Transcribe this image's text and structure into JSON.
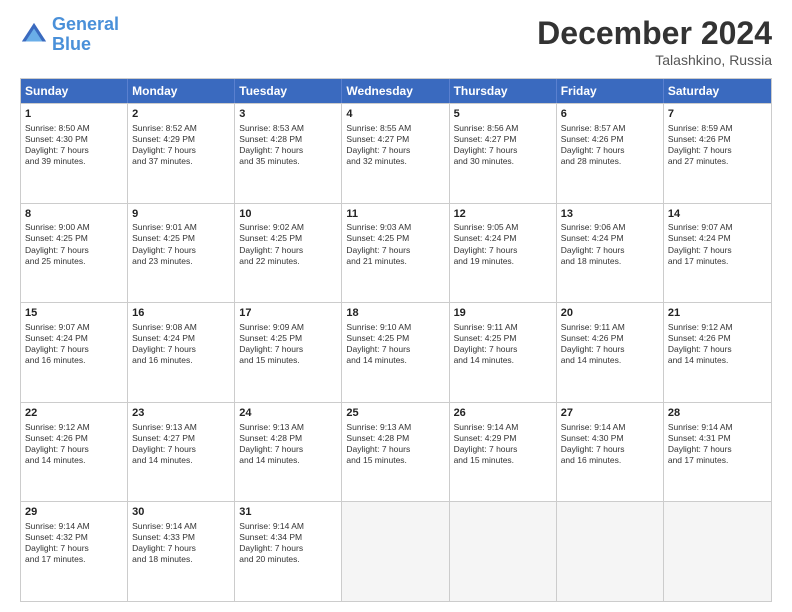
{
  "logo": {
    "line1": "General",
    "line2": "Blue"
  },
  "title": "December 2024",
  "subtitle": "Talashkino, Russia",
  "header_days": [
    "Sunday",
    "Monday",
    "Tuesday",
    "Wednesday",
    "Thursday",
    "Friday",
    "Saturday"
  ],
  "weeks": [
    [
      {
        "day": "1",
        "lines": [
          "Sunrise: 8:50 AM",
          "Sunset: 4:30 PM",
          "Daylight: 7 hours",
          "and 39 minutes."
        ]
      },
      {
        "day": "2",
        "lines": [
          "Sunrise: 8:52 AM",
          "Sunset: 4:29 PM",
          "Daylight: 7 hours",
          "and 37 minutes."
        ]
      },
      {
        "day": "3",
        "lines": [
          "Sunrise: 8:53 AM",
          "Sunset: 4:28 PM",
          "Daylight: 7 hours",
          "and 35 minutes."
        ]
      },
      {
        "day": "4",
        "lines": [
          "Sunrise: 8:55 AM",
          "Sunset: 4:27 PM",
          "Daylight: 7 hours",
          "and 32 minutes."
        ]
      },
      {
        "day": "5",
        "lines": [
          "Sunrise: 8:56 AM",
          "Sunset: 4:27 PM",
          "Daylight: 7 hours",
          "and 30 minutes."
        ]
      },
      {
        "day": "6",
        "lines": [
          "Sunrise: 8:57 AM",
          "Sunset: 4:26 PM",
          "Daylight: 7 hours",
          "and 28 minutes."
        ]
      },
      {
        "day": "7",
        "lines": [
          "Sunrise: 8:59 AM",
          "Sunset: 4:26 PM",
          "Daylight: 7 hours",
          "and 27 minutes."
        ]
      }
    ],
    [
      {
        "day": "8",
        "lines": [
          "Sunrise: 9:00 AM",
          "Sunset: 4:25 PM",
          "Daylight: 7 hours",
          "and 25 minutes."
        ]
      },
      {
        "day": "9",
        "lines": [
          "Sunrise: 9:01 AM",
          "Sunset: 4:25 PM",
          "Daylight: 7 hours",
          "and 23 minutes."
        ]
      },
      {
        "day": "10",
        "lines": [
          "Sunrise: 9:02 AM",
          "Sunset: 4:25 PM",
          "Daylight: 7 hours",
          "and 22 minutes."
        ]
      },
      {
        "day": "11",
        "lines": [
          "Sunrise: 9:03 AM",
          "Sunset: 4:25 PM",
          "Daylight: 7 hours",
          "and 21 minutes."
        ]
      },
      {
        "day": "12",
        "lines": [
          "Sunrise: 9:05 AM",
          "Sunset: 4:24 PM",
          "Daylight: 7 hours",
          "and 19 minutes."
        ]
      },
      {
        "day": "13",
        "lines": [
          "Sunrise: 9:06 AM",
          "Sunset: 4:24 PM",
          "Daylight: 7 hours",
          "and 18 minutes."
        ]
      },
      {
        "day": "14",
        "lines": [
          "Sunrise: 9:07 AM",
          "Sunset: 4:24 PM",
          "Daylight: 7 hours",
          "and 17 minutes."
        ]
      }
    ],
    [
      {
        "day": "15",
        "lines": [
          "Sunrise: 9:07 AM",
          "Sunset: 4:24 PM",
          "Daylight: 7 hours",
          "and 16 minutes."
        ]
      },
      {
        "day": "16",
        "lines": [
          "Sunrise: 9:08 AM",
          "Sunset: 4:24 PM",
          "Daylight: 7 hours",
          "and 16 minutes."
        ]
      },
      {
        "day": "17",
        "lines": [
          "Sunrise: 9:09 AM",
          "Sunset: 4:25 PM",
          "Daylight: 7 hours",
          "and 15 minutes."
        ]
      },
      {
        "day": "18",
        "lines": [
          "Sunrise: 9:10 AM",
          "Sunset: 4:25 PM",
          "Daylight: 7 hours",
          "and 14 minutes."
        ]
      },
      {
        "day": "19",
        "lines": [
          "Sunrise: 9:11 AM",
          "Sunset: 4:25 PM",
          "Daylight: 7 hours",
          "and 14 minutes."
        ]
      },
      {
        "day": "20",
        "lines": [
          "Sunrise: 9:11 AM",
          "Sunset: 4:26 PM",
          "Daylight: 7 hours",
          "and 14 minutes."
        ]
      },
      {
        "day": "21",
        "lines": [
          "Sunrise: 9:12 AM",
          "Sunset: 4:26 PM",
          "Daylight: 7 hours",
          "and 14 minutes."
        ]
      }
    ],
    [
      {
        "day": "22",
        "lines": [
          "Sunrise: 9:12 AM",
          "Sunset: 4:26 PM",
          "Daylight: 7 hours",
          "and 14 minutes."
        ]
      },
      {
        "day": "23",
        "lines": [
          "Sunrise: 9:13 AM",
          "Sunset: 4:27 PM",
          "Daylight: 7 hours",
          "and 14 minutes."
        ]
      },
      {
        "day": "24",
        "lines": [
          "Sunrise: 9:13 AM",
          "Sunset: 4:28 PM",
          "Daylight: 7 hours",
          "and 14 minutes."
        ]
      },
      {
        "day": "25",
        "lines": [
          "Sunrise: 9:13 AM",
          "Sunset: 4:28 PM",
          "Daylight: 7 hours",
          "and 15 minutes."
        ]
      },
      {
        "day": "26",
        "lines": [
          "Sunrise: 9:14 AM",
          "Sunset: 4:29 PM",
          "Daylight: 7 hours",
          "and 15 minutes."
        ]
      },
      {
        "day": "27",
        "lines": [
          "Sunrise: 9:14 AM",
          "Sunset: 4:30 PM",
          "Daylight: 7 hours",
          "and 16 minutes."
        ]
      },
      {
        "day": "28",
        "lines": [
          "Sunrise: 9:14 AM",
          "Sunset: 4:31 PM",
          "Daylight: 7 hours",
          "and 17 minutes."
        ]
      }
    ],
    [
      {
        "day": "29",
        "lines": [
          "Sunrise: 9:14 AM",
          "Sunset: 4:32 PM",
          "Daylight: 7 hours",
          "and 17 minutes."
        ]
      },
      {
        "day": "30",
        "lines": [
          "Sunrise: 9:14 AM",
          "Sunset: 4:33 PM",
          "Daylight: 7 hours",
          "and 18 minutes."
        ]
      },
      {
        "day": "31",
        "lines": [
          "Sunrise: 9:14 AM",
          "Sunset: 4:34 PM",
          "Daylight: 7 hours",
          "and 20 minutes."
        ]
      },
      null,
      null,
      null,
      null
    ]
  ]
}
